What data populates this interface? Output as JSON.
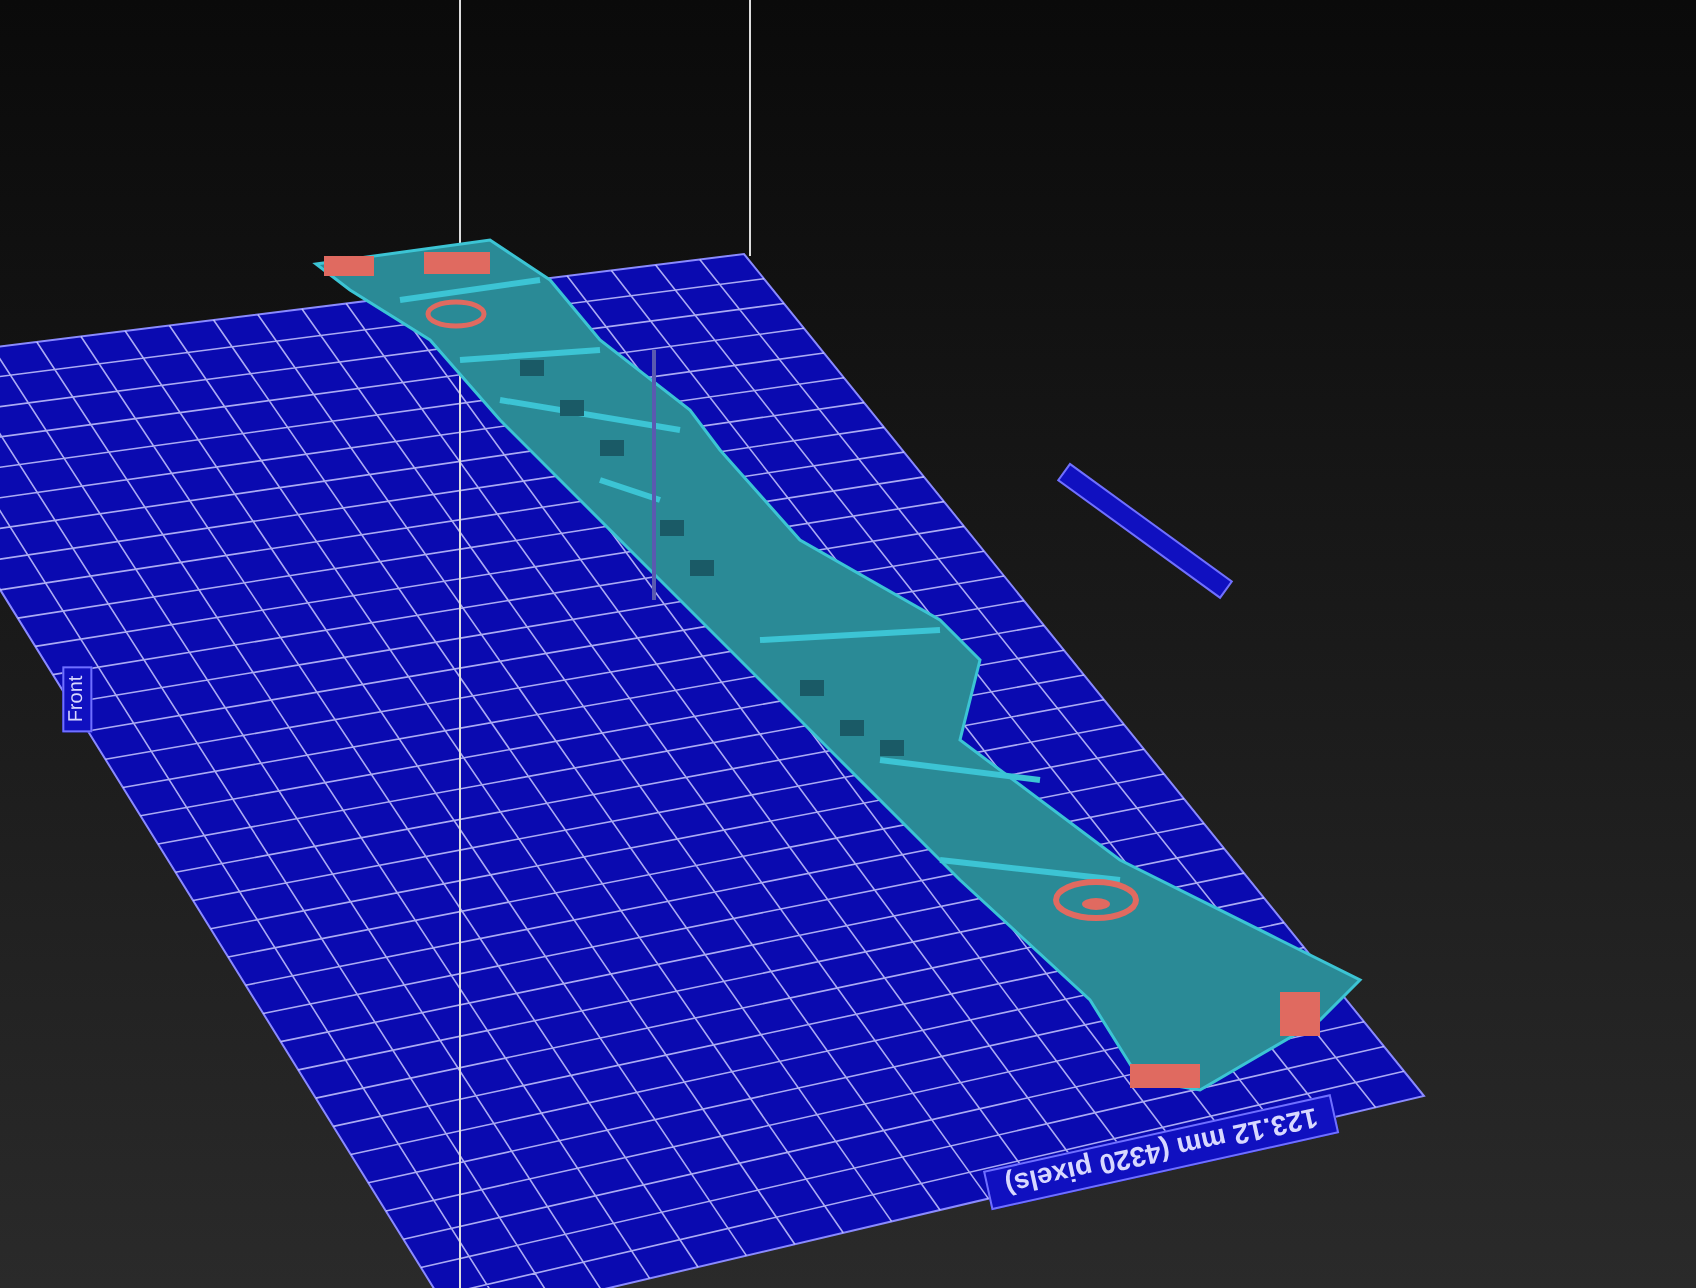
{
  "build_plate": {
    "front_label": "Front",
    "width_label": "123.12 mm (4320 pixels)"
  }
}
